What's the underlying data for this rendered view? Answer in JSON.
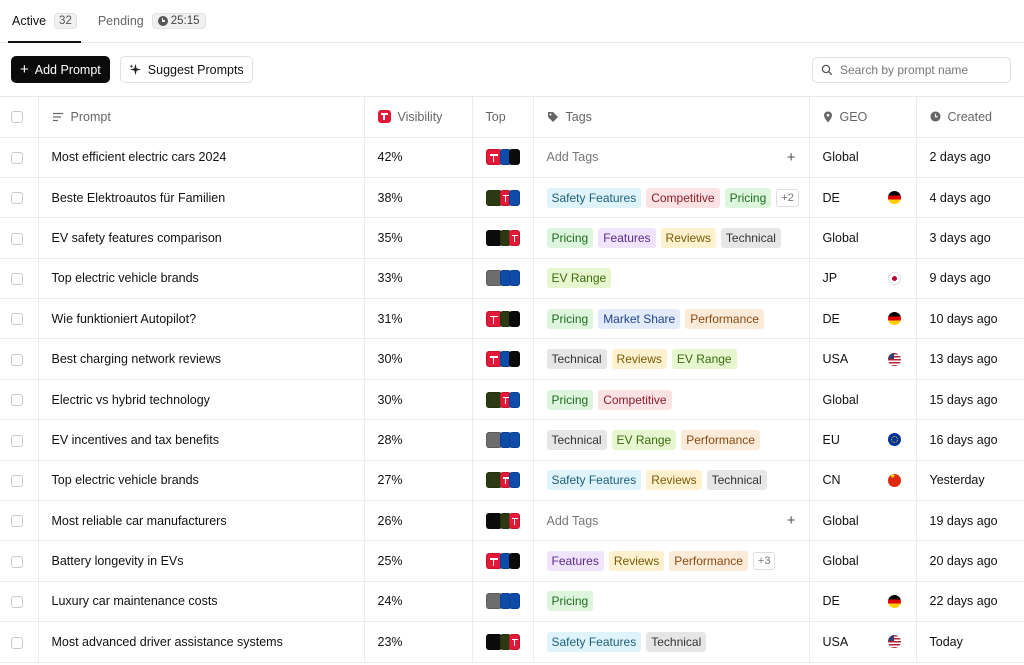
{
  "tabs": [
    {
      "label": "Active",
      "badge": "32",
      "active": true
    },
    {
      "label": "Pending",
      "timer": "25:15",
      "active": false
    }
  ],
  "toolbar": {
    "add_label": "Add Prompt",
    "suggest_label": "Suggest Prompts",
    "search_placeholder": "Search by prompt name"
  },
  "columns": {
    "prompt": "Prompt",
    "visibility": "Visibility",
    "top": "Top",
    "tags": "Tags",
    "geo": "GEO",
    "created": "Created"
  },
  "tag_colors": {
    "Safety Features": {
      "bg": "#dff3fb",
      "fg": "#1d5f7a"
    },
    "Competitive": {
      "bg": "#fde2e4",
      "fg": "#8a1f2b"
    },
    "Pricing": {
      "bg": "#dcf5dc",
      "fg": "#216b21"
    },
    "Features": {
      "bg": "#efe4fb",
      "fg": "#5b2a8a"
    },
    "Reviews": {
      "bg": "#fdf1cf",
      "fg": "#7a5a06"
    },
    "Technical": {
      "bg": "#e6e6e6",
      "fg": "#333333"
    },
    "EV Range": {
      "bg": "#e6f6cf",
      "fg": "#3f6a0f"
    },
    "Market Share": {
      "bg": "#e2ebfb",
      "fg": "#24438a"
    },
    "Performance": {
      "bg": "#fdebd9",
      "fg": "#8a4a12"
    }
  },
  "top_colors": {
    "red": "#e31937",
    "blue": "#0f4ba8",
    "dark": "#0b0b0b",
    "olive": "#2b3a12",
    "gray": "#6d6d6d"
  },
  "rows": [
    {
      "prompt": "Most efficient electric cars 2024",
      "visibility": "42%",
      "top": [
        "red",
        "blue",
        "dark"
      ],
      "tags": [],
      "add_tags": "Add Tags",
      "geo": "Global",
      "flag": "",
      "created": "2 days ago"
    },
    {
      "prompt": "Beste Elektroautos für Familien",
      "visibility": "38%",
      "top": [
        "olive",
        "red",
        "blue"
      ],
      "tags": [
        "Safety Features",
        "Competitive",
        "Pricing"
      ],
      "more": "+2",
      "geo": "DE",
      "flag": "de",
      "created": "4 days ago"
    },
    {
      "prompt": "EV safety features comparison",
      "visibility": "35%",
      "top": [
        "dark",
        "olive",
        "red"
      ],
      "tags": [
        "Pricing",
        "Features",
        "Reviews",
        "Technical"
      ],
      "geo": "Global",
      "flag": "",
      "created": "3 days ago"
    },
    {
      "prompt": "Top electric vehicle brands",
      "visibility": "33%",
      "top": [
        "gray",
        "blue",
        "blue"
      ],
      "tags": [
        "EV Range"
      ],
      "geo": "JP",
      "flag": "jp",
      "created": "9 days ago"
    },
    {
      "prompt": "Wie funktioniert Autopilot?",
      "visibility": "31%",
      "top": [
        "red",
        "olive",
        "dark"
      ],
      "tags": [
        "Pricing",
        "Market Share",
        "Performance"
      ],
      "geo": "DE",
      "flag": "de",
      "created": "10 days ago"
    },
    {
      "prompt": "Best charging network reviews",
      "visibility": "30%",
      "top": [
        "red",
        "blue",
        "dark"
      ],
      "tags": [
        "Technical",
        "Reviews",
        "EV Range"
      ],
      "geo": "USA",
      "flag": "us",
      "created": "13 days ago"
    },
    {
      "prompt": "Electric vs hybrid technology",
      "visibility": "30%",
      "top": [
        "olive",
        "red",
        "blue"
      ],
      "tags": [
        "Pricing",
        "Competitive"
      ],
      "geo": "Global",
      "flag": "",
      "created": "15 days ago"
    },
    {
      "prompt": "EV incentives and tax benefits",
      "visibility": "28%",
      "top": [
        "gray",
        "blue",
        "blue"
      ],
      "tags": [
        "Technical",
        "EV Range",
        "Performance"
      ],
      "geo": "EU",
      "flag": "eu",
      "created": "16 days ago"
    },
    {
      "prompt": "Top electric vehicle brands",
      "visibility": "27%",
      "top": [
        "olive",
        "red",
        "blue"
      ],
      "tags": [
        "Safety Features",
        "Reviews",
        "Technical"
      ],
      "geo": "CN",
      "flag": "cn",
      "created": "Yesterday"
    },
    {
      "prompt": "Most reliable car manufacturers",
      "visibility": "26%",
      "top": [
        "dark",
        "olive",
        "red"
      ],
      "tags": [],
      "add_tags": "Add Tags",
      "geo": "Global",
      "flag": "",
      "created": "19 days ago"
    },
    {
      "prompt": "Battery longevity in EVs",
      "visibility": "25%",
      "top": [
        "red",
        "blue",
        "dark"
      ],
      "tags": [
        "Features",
        "Reviews",
        "Performance"
      ],
      "more": "+3",
      "geo": "Global",
      "flag": "",
      "created": "20 days ago"
    },
    {
      "prompt": "Luxury car maintenance costs",
      "visibility": "24%",
      "top": [
        "gray",
        "blue",
        "blue"
      ],
      "tags": [
        "Pricing"
      ],
      "geo": "DE",
      "flag": "de",
      "created": "22 days ago"
    },
    {
      "prompt": "Most advanced driver assistance systems",
      "visibility": "23%",
      "top": [
        "dark",
        "olive",
        "red"
      ],
      "tags": [
        "Safety Features",
        "Technical"
      ],
      "geo": "USA",
      "flag": "us",
      "created": "Today"
    }
  ]
}
